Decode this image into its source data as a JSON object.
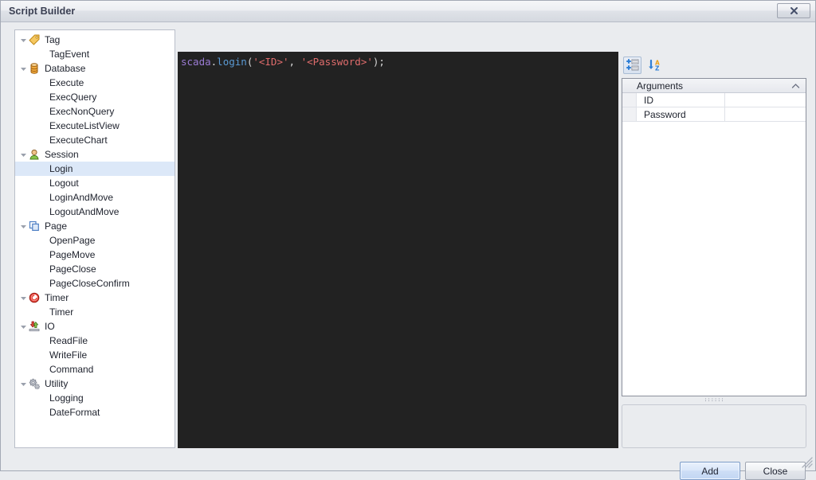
{
  "window": {
    "title": "Script Builder",
    "close_label": "✕"
  },
  "tree": {
    "nodes": [
      {
        "label": "Tag",
        "level": 0,
        "icon": "tag-icon",
        "expander": "down"
      },
      {
        "label": "TagEvent",
        "level": 1,
        "icon": null,
        "expander": null
      },
      {
        "label": "Database",
        "level": 0,
        "icon": "database-icon",
        "expander": "down"
      },
      {
        "label": "Execute",
        "level": 1,
        "icon": null,
        "expander": null
      },
      {
        "label": "ExecQuery",
        "level": 1,
        "icon": null,
        "expander": null
      },
      {
        "label": "ExecNonQuery",
        "level": 1,
        "icon": null,
        "expander": null
      },
      {
        "label": "ExecuteListView",
        "level": 1,
        "icon": null,
        "expander": null
      },
      {
        "label": "ExecuteChart",
        "level": 1,
        "icon": null,
        "expander": null
      },
      {
        "label": "Session",
        "level": 0,
        "icon": "user-icon",
        "expander": "down"
      },
      {
        "label": "Login",
        "level": 1,
        "icon": null,
        "expander": null,
        "selected": true
      },
      {
        "label": "Logout",
        "level": 1,
        "icon": null,
        "expander": null
      },
      {
        "label": "LoginAndMove",
        "level": 1,
        "icon": null,
        "expander": null
      },
      {
        "label": "LogoutAndMove",
        "level": 1,
        "icon": null,
        "expander": null
      },
      {
        "label": "Page",
        "level": 0,
        "icon": "pages-icon",
        "expander": "down"
      },
      {
        "label": "OpenPage",
        "level": 1,
        "icon": null,
        "expander": null
      },
      {
        "label": "PageMove",
        "level": 1,
        "icon": null,
        "expander": null
      },
      {
        "label": "PageClose",
        "level": 1,
        "icon": null,
        "expander": null
      },
      {
        "label": "PageCloseConfirm",
        "level": 1,
        "icon": null,
        "expander": null
      },
      {
        "label": "Timer",
        "level": 0,
        "icon": "timer-icon",
        "expander": "down"
      },
      {
        "label": "Timer",
        "level": 1,
        "icon": null,
        "expander": null
      },
      {
        "label": "IO",
        "level": 0,
        "icon": "io-icon",
        "expander": "down"
      },
      {
        "label": "ReadFile",
        "level": 1,
        "icon": null,
        "expander": null
      },
      {
        "label": "WriteFile",
        "level": 1,
        "icon": null,
        "expander": null
      },
      {
        "label": "Command",
        "level": 1,
        "icon": null,
        "expander": null
      },
      {
        "label": "Utility",
        "level": 0,
        "icon": "gears-icon",
        "expander": "down"
      },
      {
        "label": "Logging",
        "level": 1,
        "icon": null,
        "expander": null
      },
      {
        "label": "DateFormat",
        "level": 1,
        "icon": null,
        "expander": null
      }
    ]
  },
  "editor": {
    "code_tokens": [
      {
        "text": "scada",
        "type": "obj"
      },
      {
        "text": ".",
        "type": "punct"
      },
      {
        "text": "login",
        "type": "fn"
      },
      {
        "text": "(",
        "type": "punct"
      },
      {
        "text": "'<ID>'",
        "type": "str"
      },
      {
        "text": ", ",
        "type": "punct"
      },
      {
        "text": "'<Password>'",
        "type": "str"
      },
      {
        "text": ");",
        "type": "punct"
      }
    ],
    "plain_code": "scada.login('<ID>', '<Password>');"
  },
  "properties": {
    "toolbar": {
      "categorized_label": "categorized-icon",
      "alphabetical_label": "sort-alpha-icon"
    },
    "category": {
      "label": "Arguments",
      "collapse_glyph": "⌃"
    },
    "rows": [
      {
        "name": "ID",
        "value": ""
      },
      {
        "name": "Password",
        "value": ""
      }
    ],
    "description": ""
  },
  "footer": {
    "add_label": "Add",
    "close_label": "Close"
  },
  "colors": {
    "accent_selection": "#dce8f8",
    "editor_background": "#222222",
    "token_object": "#9b7bd4",
    "token_function": "#5b9bd5",
    "token_string": "#e06c6c",
    "window_chrome": "#eaecef"
  }
}
